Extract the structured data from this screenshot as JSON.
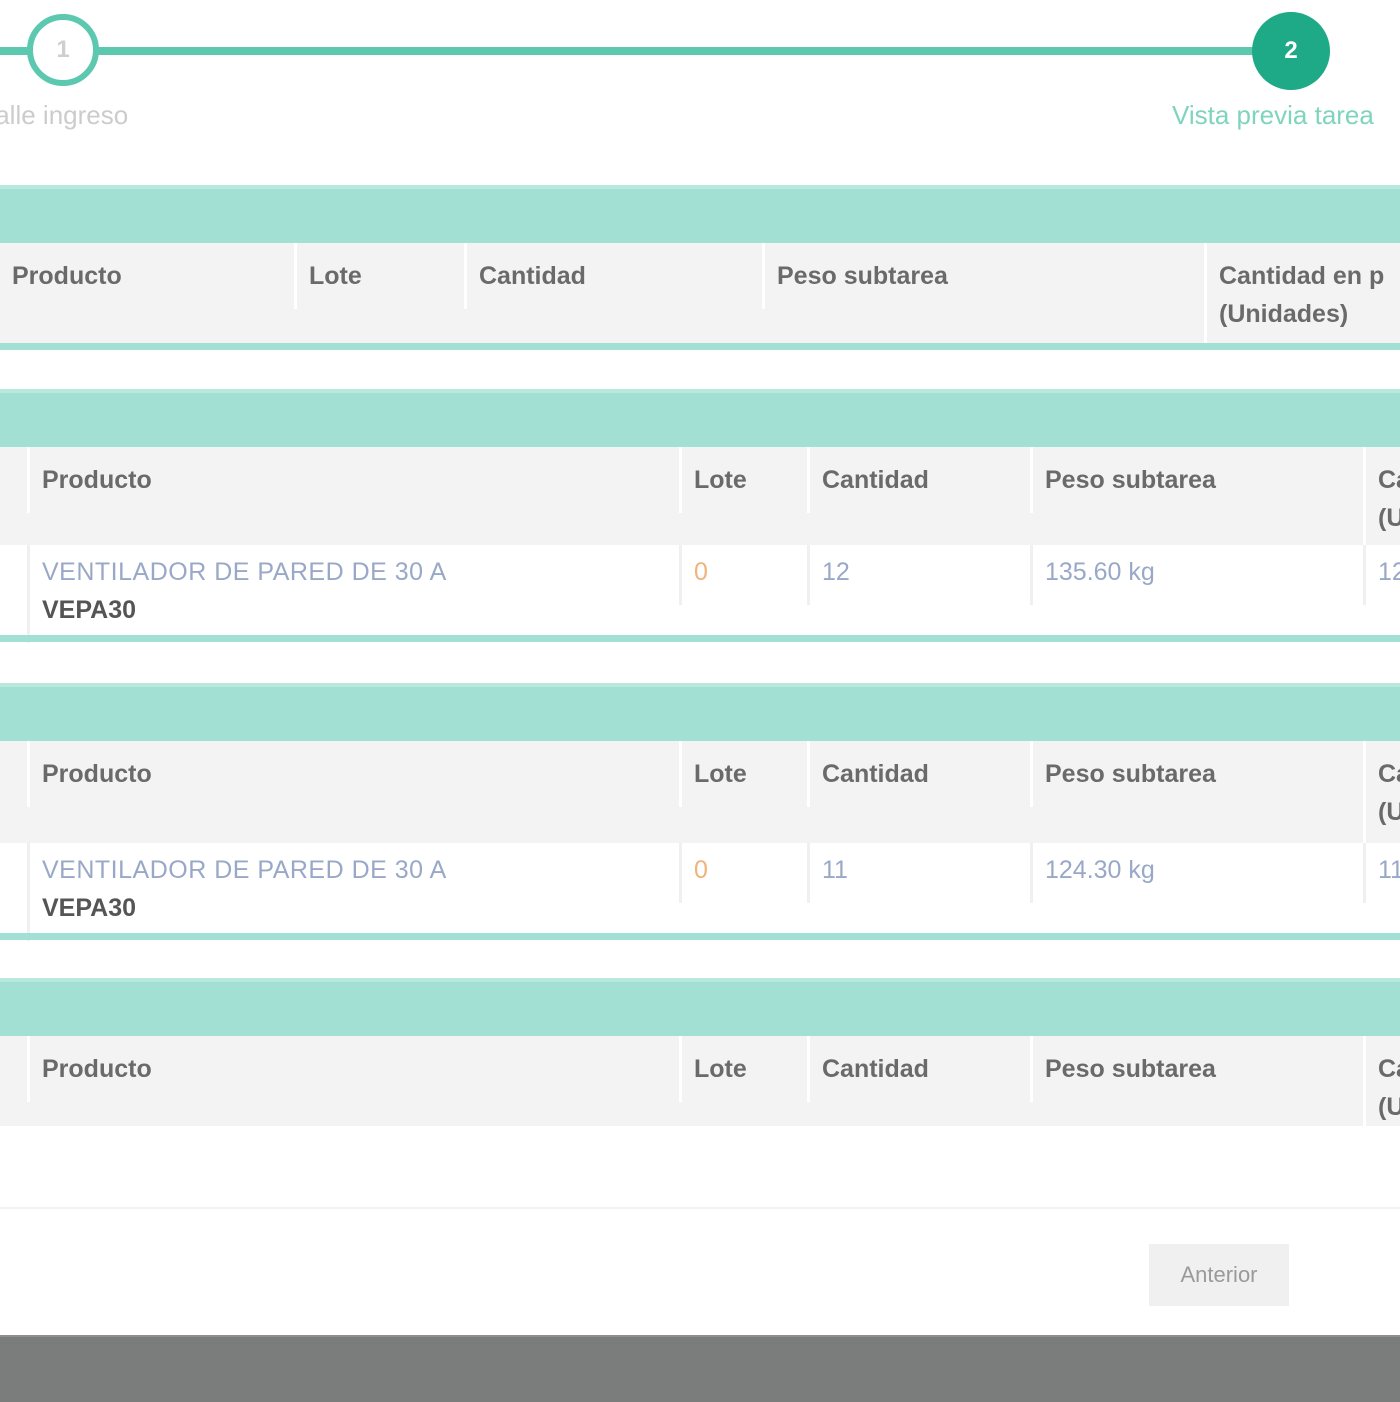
{
  "stepper": {
    "steps": [
      {
        "number": "1",
        "label": "talle ingreso"
      },
      {
        "number": "2",
        "label": "Vista previa tarea"
      }
    ]
  },
  "panels": [
    {
      "headers": [
        "Producto",
        "Lote",
        "Cantidad",
        "Peso subtarea",
        "Cantidad en p",
        "(Unidades)"
      ],
      "rows": []
    },
    {
      "headers": [
        "Producto",
        "Lote",
        "Cantidad",
        "Peso subtarea",
        "Ca",
        "(U"
      ],
      "rows": [
        {
          "product_name": "VENTILADOR DE PARED DE 30 A",
          "product_code": "VEPA30",
          "lote": "0",
          "cantidad": "12",
          "peso": "135.60 kg",
          "unidades": "12"
        }
      ]
    },
    {
      "headers": [
        "Producto",
        "Lote",
        "Cantidad",
        "Peso subtarea",
        "Ca",
        "(U"
      ],
      "rows": [
        {
          "product_name": "VENTILADOR DE PARED DE 30 A",
          "product_code": "VEPA30",
          "lote": "0",
          "cantidad": "11",
          "peso": "124.30 kg",
          "unidades": "11"
        }
      ]
    },
    {
      "headers": [
        "Producto",
        "Lote",
        "Cantidad",
        "Peso subtarea",
        "Ca",
        "(U"
      ],
      "rows": []
    }
  ],
  "footer": {
    "back_label": "Anterior"
  }
}
